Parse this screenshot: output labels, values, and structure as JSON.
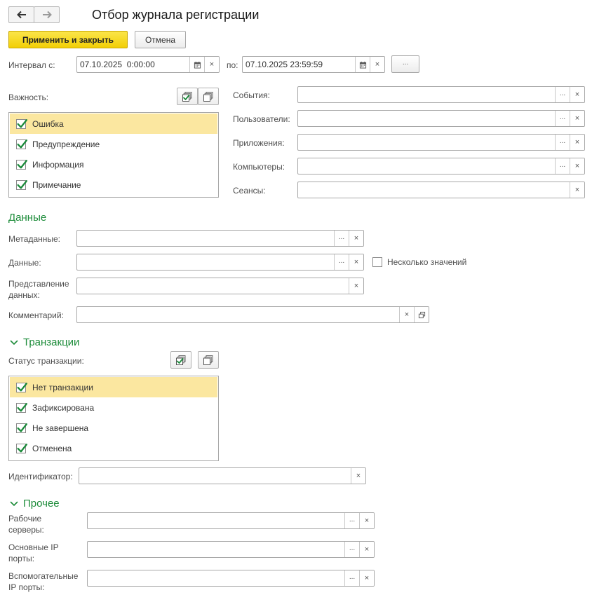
{
  "window": {
    "title": "Отбор журнала регистрации",
    "back_icon": "arrow-left-icon",
    "forward_icon": "arrow-right-icon"
  },
  "toolbar": {
    "apply_label": "Применить и закрыть",
    "cancel_label": "Отмена"
  },
  "interval": {
    "from_label": "Интервал с:",
    "from_value": "07.10.2025  0:00:00",
    "to_label": "по:",
    "to_value": "07.10.2025 23:59:59",
    "more_label": "..."
  },
  "importance": {
    "label": "Важность:",
    "items": [
      {
        "label": "Ошибка",
        "checked": true,
        "selected": true
      },
      {
        "label": "Предупреждение",
        "checked": true,
        "selected": false
      },
      {
        "label": "Информация",
        "checked": true,
        "selected": false
      },
      {
        "label": "Примечание",
        "checked": true,
        "selected": false
      }
    ]
  },
  "filters": {
    "events_label": "События:",
    "events_value": "",
    "users_label": "Пользователи:",
    "users_value": "",
    "apps_label": "Приложения:",
    "apps_value": "",
    "computers_label": "Компьютеры:",
    "computers_value": "",
    "sessions_label": "Сеансы:",
    "sessions_value": ""
  },
  "data_section": {
    "title": "Данные",
    "metadata_label": "Метаданные:",
    "metadata_value": "",
    "data_label": "Данные:",
    "data_value": "",
    "multiple_values_label": "Несколько значений",
    "multiple_values_checked": false,
    "presentation_label": "Представление данных:",
    "presentation_value": "",
    "comment_label": "Комментарий:",
    "comment_value": ""
  },
  "transactions": {
    "title": "Транзакции",
    "status_label": "Статус транзакции:",
    "items": [
      {
        "label": "Нет транзакции",
        "checked": true,
        "selected": true
      },
      {
        "label": "Зафиксирована",
        "checked": true,
        "selected": false
      },
      {
        "label": "Не завершена",
        "checked": true,
        "selected": false
      },
      {
        "label": "Отменена",
        "checked": true,
        "selected": false
      }
    ],
    "id_label": "Идентификатор:",
    "id_value": ""
  },
  "other": {
    "title": "Прочее",
    "work_servers_label": "Рабочие серверы:",
    "work_servers_value": "",
    "main_ports_label": "Основные IP порты:",
    "main_ports_value": "",
    "aux_ports_label": "Вспомогательные IP порты:",
    "aux_ports_value": ""
  },
  "colors": {
    "accent_green": "#1d8c3a",
    "selected_row": "#fbe7a0",
    "primary_button": "#f2cf06"
  }
}
